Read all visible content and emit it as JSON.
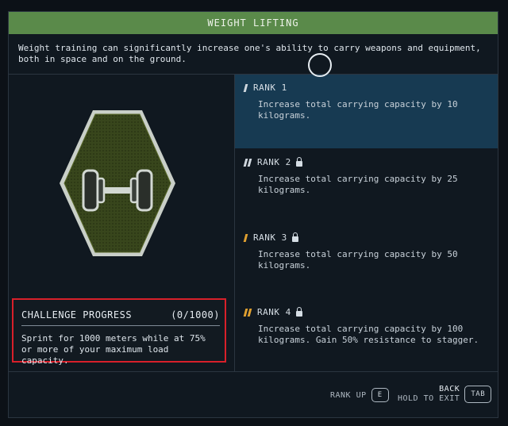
{
  "title": "WEIGHT LIFTING",
  "description": "Weight training can significantly increase one's ability to carry weapons and equipment, both in space and on the ground.",
  "badge": {
    "icon": "dumbbell-icon"
  },
  "challenge": {
    "heading": "CHALLENGE PROGRESS",
    "progress": "(0/1000)",
    "text": "Sprint for 1000 meters while at 75% or more of your maximum load capacity."
  },
  "ranks": [
    {
      "label": "RANK 1",
      "text": "Increase total carrying capacity by 10 kilograms.",
      "locked": false,
      "active": true
    },
    {
      "label": "RANK 2",
      "text": "Increase total carrying capacity by 25 kilograms.",
      "locked": true,
      "active": false
    },
    {
      "label": "RANK 3",
      "text": "Increase total carrying capacity by 50 kilograms.",
      "locked": true,
      "active": false
    },
    {
      "label": "RANK 4",
      "text": "Increase total carrying capacity by 100 kilograms. Gain 50% resistance to stagger.",
      "locked": true,
      "active": false
    }
  ],
  "controls": {
    "rank_up_label": "RANK UP",
    "rank_up_key": "E",
    "back_label": "BACK",
    "hold_exit_label": "HOLD TO EXIT",
    "back_key": "TAB"
  },
  "colors": {
    "title_bar": "#5a8a4a",
    "active_rank": "#173a52",
    "challenge_border": "#d8202a",
    "rank_accent": "#e0a030"
  }
}
